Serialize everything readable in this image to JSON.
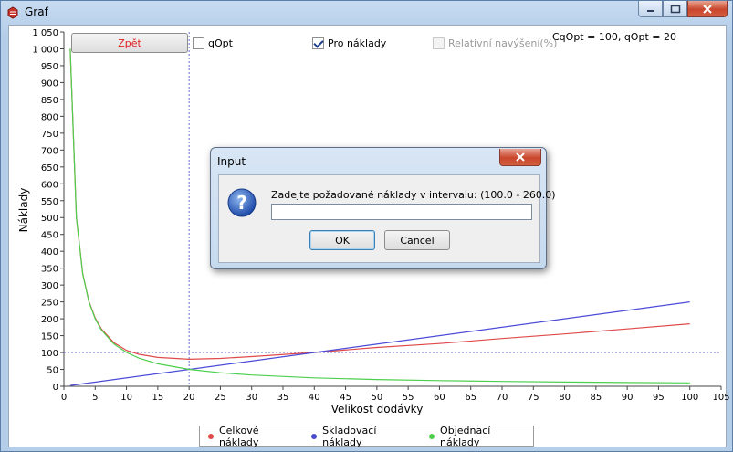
{
  "window": {
    "title": "Graf"
  },
  "toolbar": {
    "back_label": "Zpět",
    "qopt_label": "qOpt",
    "qopt_checked": false,
    "cost_label": "Pro náklady",
    "cost_checked": true,
    "relative_label": "Relativní navýšení(%)",
    "relative_checked": false,
    "relative_enabled": false,
    "info_text": "CqOpt = 100, qOpt = 20"
  },
  "legend": {
    "items": [
      {
        "label": "Celkové náklady",
        "color": "#e04a4a"
      },
      {
        "label": "Skladovací náklady",
        "color": "#4b4bd8"
      },
      {
        "label": "Objednací náklady",
        "color": "#4ccf4c"
      }
    ]
  },
  "dialog": {
    "title": "Input",
    "prompt": "Zadejte požadované náklady v intervalu: (100.0 - 260.0)",
    "input_value": "",
    "ok_label": "OK",
    "cancel_label": "Cancel"
  },
  "chart_data": {
    "type": "line",
    "xlabel": "Velikost dodávky",
    "ylabel": "Náklady",
    "xlim": [
      0,
      105
    ],
    "ylim": [
      0,
      1050
    ],
    "x_ticks": [
      "0",
      "5",
      "10",
      "15",
      "20",
      "25",
      "30",
      "35",
      "40",
      "45",
      "50",
      "55",
      "60",
      "65",
      "70",
      "75",
      "80",
      "85",
      "90",
      "95",
      "100",
      "105"
    ],
    "y_ticks": [
      "0",
      "50",
      "100",
      "150",
      "200",
      "250",
      "300",
      "350",
      "400",
      "450",
      "500",
      "550",
      "600",
      "650",
      "700",
      "750",
      "800",
      "850",
      "900",
      "950",
      "1 000",
      "1 050"
    ],
    "reference_lines": {
      "x": 20,
      "y": 100
    },
    "series": [
      {
        "name": "Celkové náklady",
        "color": "#e04a4a",
        "x": [
          1,
          2,
          3,
          4,
          5,
          6,
          8,
          10,
          12,
          15,
          20,
          25,
          30,
          40,
          50,
          60,
          70,
          80,
          90,
          100
        ],
        "y": [
          1000.1,
          500.5,
          334.2,
          251.6,
          202.5,
          169.7,
          129.0,
          106.4,
          94.8,
          85.6,
          80.0,
          82.5,
          87.9,
          100.0,
          115.0,
          126.7,
          141.4,
          155.0,
          170.0,
          185.0
        ]
      },
      {
        "name": "Skladovací náklady",
        "color": "#4b4bd8",
        "x": [
          1,
          100
        ],
        "y": [
          2.5,
          250
        ]
      },
      {
        "name": "Objednací náklady",
        "color": "#4ccf4c",
        "x": [
          1,
          2,
          3,
          4,
          5,
          6,
          8,
          10,
          12,
          15,
          20,
          25,
          30,
          40,
          50,
          60,
          70,
          80,
          90,
          100
        ],
        "y": [
          1000,
          500,
          333.3,
          250,
          200,
          166.7,
          125,
          100,
          83.3,
          66.7,
          50,
          40,
          33.3,
          25,
          20,
          16.7,
          14.3,
          12.5,
          11.1,
          10
        ]
      }
    ]
  }
}
